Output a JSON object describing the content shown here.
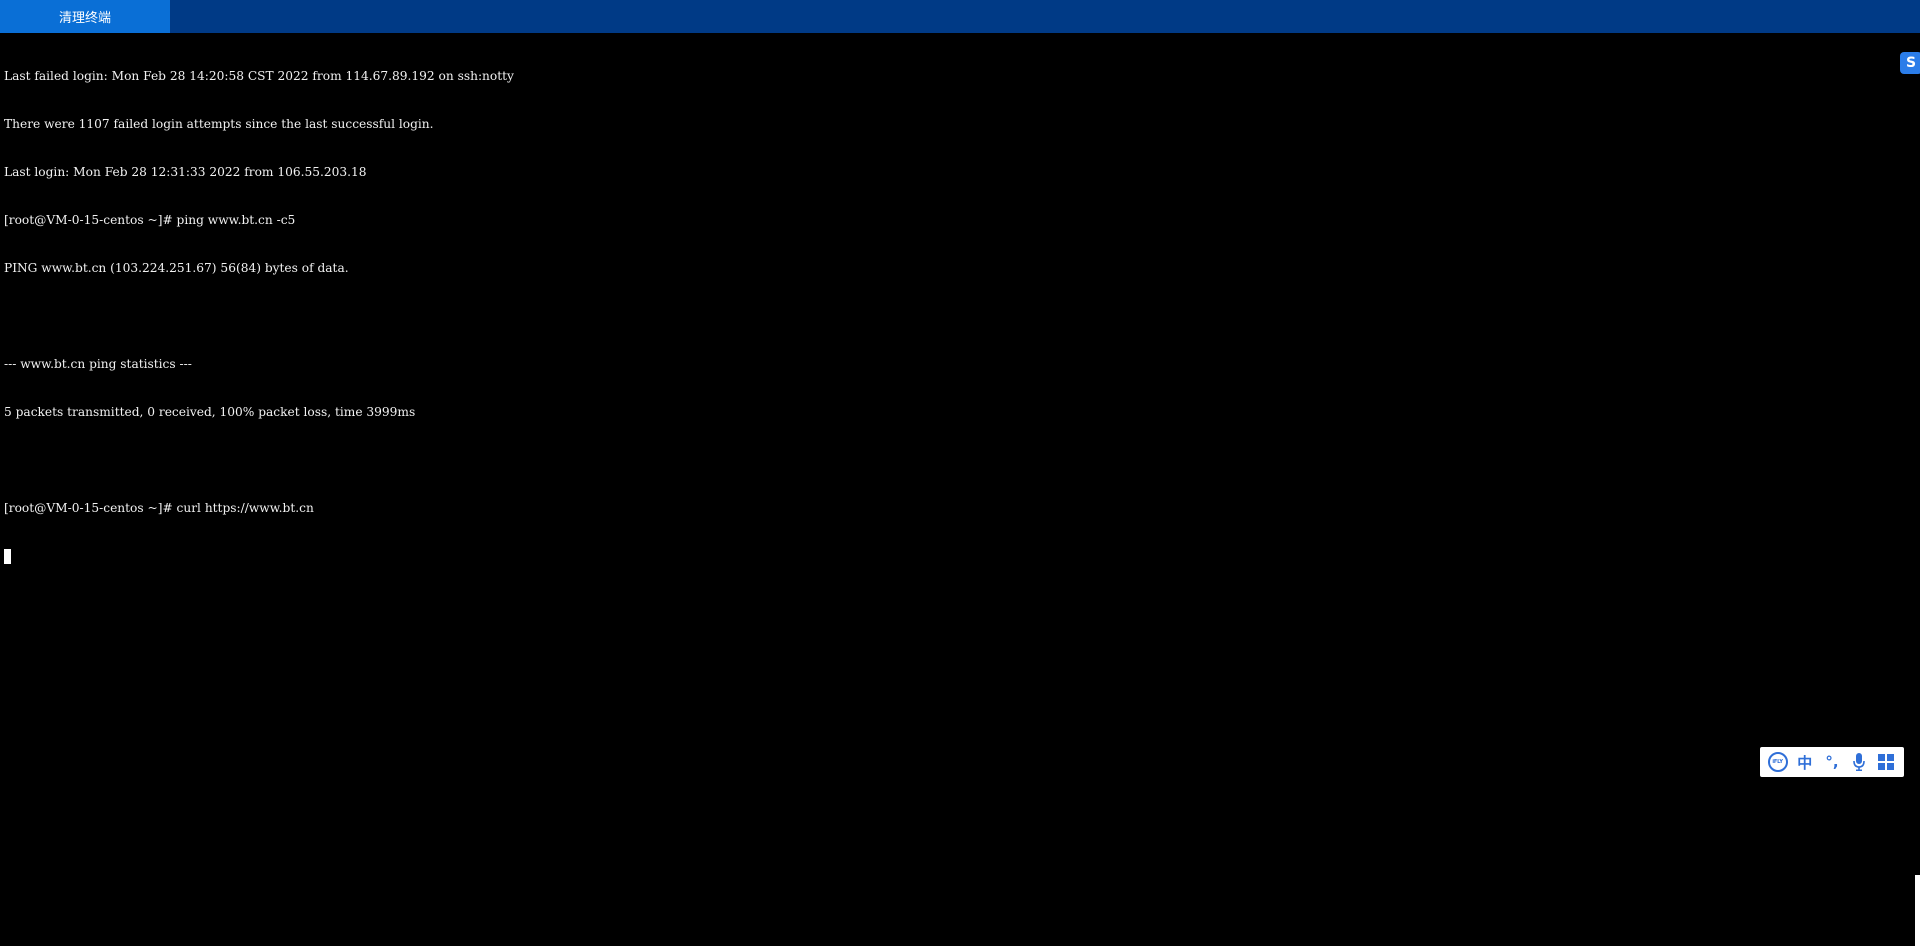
{
  "toolbar": {
    "clear_label": "清理终端"
  },
  "terminal": {
    "lines": [
      "Last failed login: Mon Feb 28 14:20:58 CST 2022 from 114.67.89.192 on ssh:notty",
      "There were 1107 failed login attempts since the last successful login.",
      "Last login: Mon Feb 28 12:31:33 2022 from 106.55.203.18",
      "[root@VM-0-15-centos ~]# ping www.bt.cn -c5",
      "PING www.bt.cn (103.224.251.67) 56(84) bytes of data.",
      "",
      "--- www.bt.cn ping statistics ---",
      "5 packets transmitted, 0 received, 100% packet loss, time 3999ms",
      "",
      "[root@VM-0-15-centos ~]# curl https://www.bt.cn"
    ]
  },
  "side_icon": {
    "name": "s-logo-icon",
    "glyph": "S"
  },
  "ime": {
    "logo_text": "iFLY",
    "lang_label": "中",
    "punct_label": "°,",
    "items": [
      "iflytek-logo-icon",
      "chinese-mode-icon",
      "punctuation-icon",
      "microphone-icon",
      "apps-grid-icon"
    ]
  },
  "colors": {
    "topbar": "#003a86",
    "button": "#0a6fd6",
    "terminal_bg": "#000000",
    "terminal_fg": "#f2f2f2",
    "ime_accent": "#2f6fd8"
  }
}
